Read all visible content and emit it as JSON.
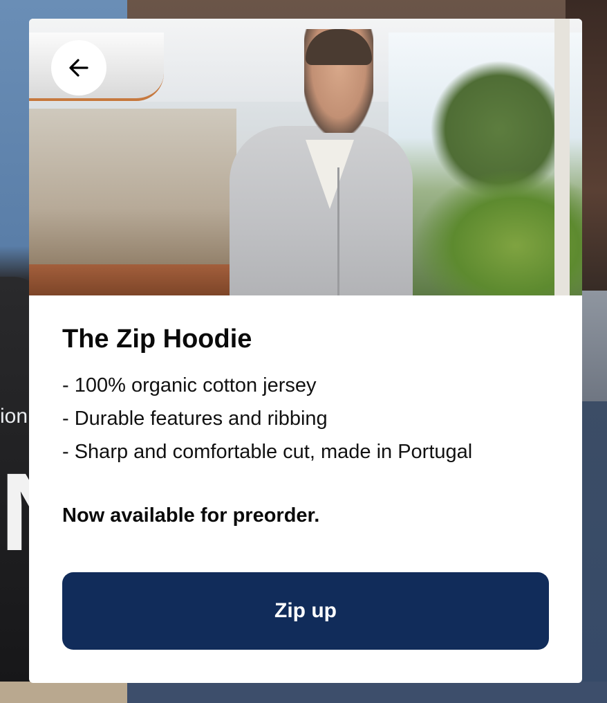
{
  "background": {
    "partial_text": "ion",
    "partial_large_text": "N"
  },
  "modal": {
    "back_icon": "arrow-left-icon",
    "product_title": "The Zip Hoodie",
    "features": [
      "- 100% organic cotton jersey",
      "- Durable features and ribbing",
      "- Sharp and comfortable cut, made in Portugal"
    ],
    "note": "Now available for preorder.",
    "cta_label": "Zip up"
  },
  "colors": {
    "cta_background": "#112c5a",
    "cta_text": "#ffffff",
    "modal_background": "#ffffff"
  }
}
